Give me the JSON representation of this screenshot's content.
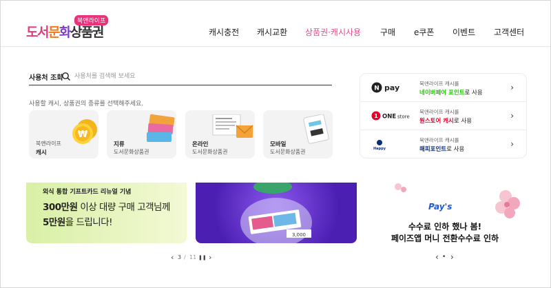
{
  "header": {
    "logo_text": [
      "도서",
      "문",
      "화",
      "상품권"
    ],
    "logo_badge": "북앤라이프",
    "nav": [
      "캐시충전",
      "캐시교환",
      "상품권·캐시사용",
      "구매",
      "e쿠폰",
      "이벤트",
      "고객센터"
    ],
    "active_index": 2
  },
  "search": {
    "label": "사용처 조회",
    "placeholder": "사용처를 검색해 보세요"
  },
  "hint": "사용할 캐시, 상품권의 종류를 선택해주세요.",
  "cards": [
    {
      "top": "북앤라이프",
      "bottom": "캐시",
      "style": "small-top"
    },
    {
      "top": "지류",
      "bottom": "도서문화상품권",
      "style": "bold-top"
    },
    {
      "top": "온라인",
      "bottom": "도서문화상품권",
      "style": "bold-top"
    },
    {
      "top": "모바일",
      "bottom": "도서문화상품권",
      "style": "bold-top"
    }
  ],
  "use_list": [
    {
      "brand": "N pay",
      "small": "북앤라이프 캐시를",
      "main_bold": "네이버페이 포인트",
      "main_rest": "로 사용",
      "color": "#1ec800"
    },
    {
      "brand": "ONE store",
      "small": "북앤라이프 캐시를",
      "main_bold": "원스토어 캐시",
      "main_rest": "로 사용",
      "color": "#e4002b"
    },
    {
      "brand": "Happy Point",
      "small": "북앤라이프 캐시를",
      "main_bold": "해피포인트",
      "main_rest": "로 사용",
      "color": "#0c2a7a"
    }
  ],
  "banner1": {
    "line1": "외식 통합 기프트카드 리뉴얼 기념",
    "line2_bold": "300만원",
    "line2_rest": " 이상 대량 구매 고객님께",
    "line3_bold": "5만원",
    "line3_rest": "을 드립니다!"
  },
  "banner2": {
    "amount": "3,000"
  },
  "banner3": {
    "brand": "Pay's",
    "line1": "수수료 인하 했나 봄!",
    "line2": "페이즈앱 머니 전환수수료 인하"
  },
  "pager": {
    "prev": "‹",
    "current": "3",
    "sep": "/",
    "total": "11",
    "pause": "❚❚",
    "next": "›"
  },
  "pager2": {
    "prev": "‹",
    "dot": "•",
    "next": "›"
  },
  "colors": {
    "accent_pink": "#e44b8d",
    "highlight_red": "#d11111",
    "naver_green": "#1ec800"
  }
}
